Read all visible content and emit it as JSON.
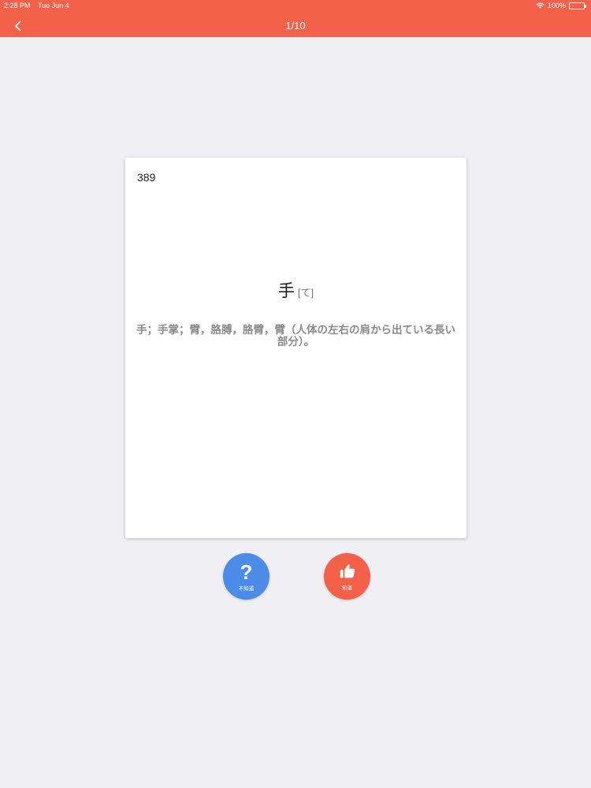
{
  "status_bar": {
    "time": "2:28 PM",
    "date": "Tue Jun 4",
    "battery": "100%"
  },
  "header": {
    "title": "1/10",
    "back_icon": "chevron-left-icon",
    "color": "#f4614a"
  },
  "card": {
    "number": "389",
    "word": "手",
    "reading": "[て]",
    "meaning": "手；手掌；臂，胳膊，胳臂，臂（人体の左右の肩から出ている長い部分）。"
  },
  "actions": {
    "unknown": {
      "label": "不知道",
      "icon": "question-mark-icon",
      "color": "#4c8be8"
    },
    "known": {
      "label": "知道",
      "icon": "thumbs-up-icon",
      "color": "#f4614a"
    }
  }
}
